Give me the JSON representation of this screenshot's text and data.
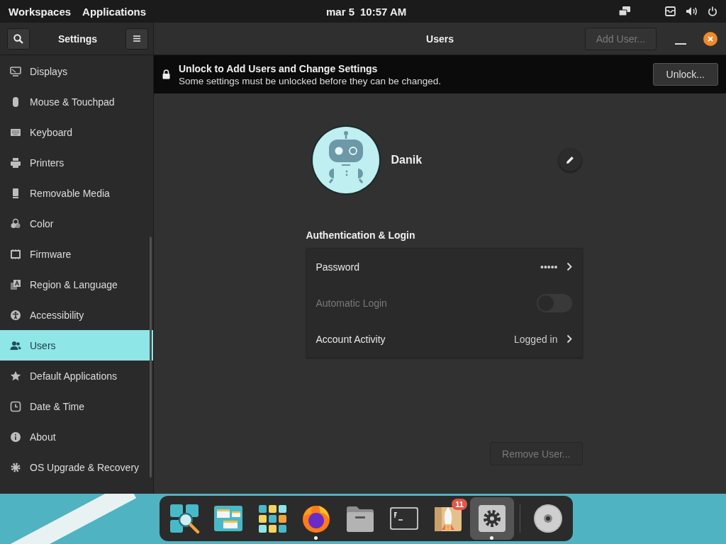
{
  "top_panel": {
    "workspaces": "Workspaces",
    "applications": "Applications",
    "date": "mar 5",
    "time": "10:57 AM"
  },
  "sidebar": {
    "title": "Settings",
    "items": [
      {
        "label": "Displays",
        "kind": "display",
        "selected": false
      },
      {
        "label": "Mouse & Touchpad",
        "kind": "mouse",
        "selected": false
      },
      {
        "label": "Keyboard",
        "kind": "keyboard",
        "selected": false
      },
      {
        "label": "Printers",
        "kind": "printer",
        "selected": false
      },
      {
        "label": "Removable Media",
        "kind": "removable",
        "selected": false
      },
      {
        "label": "Color",
        "kind": "color",
        "selected": false
      },
      {
        "label": "Firmware",
        "kind": "firmware",
        "selected": false
      },
      {
        "label": "Region & Language",
        "kind": "region",
        "selected": false
      },
      {
        "label": "Accessibility",
        "kind": "accessibility",
        "selected": false
      },
      {
        "label": "Users",
        "kind": "users",
        "selected": true
      },
      {
        "label": "Default Applications",
        "kind": "star",
        "selected": false
      },
      {
        "label": "Date & Time",
        "kind": "clock",
        "selected": false
      },
      {
        "label": "About",
        "kind": "info",
        "selected": false
      },
      {
        "label": "OS Upgrade & Recovery",
        "kind": "gear",
        "selected": false
      }
    ]
  },
  "header": {
    "title": "Users",
    "add_user": {
      "label": "Add User...",
      "disabled": true
    }
  },
  "infobar": {
    "title": "Unlock to Add Users and Change Settings",
    "message": "Some settings must be unlocked before they can be changed.",
    "button": "Unlock..."
  },
  "user": {
    "name": "Danik"
  },
  "auth": {
    "heading": "Authentication & Login",
    "rows": [
      {
        "kind": "link",
        "label": "Password",
        "value": "•••••",
        "disabled": false
      },
      {
        "kind": "switch",
        "label": "Automatic Login",
        "on": false,
        "disabled": true
      },
      {
        "kind": "link",
        "label": "Account Activity",
        "value": "Logged in",
        "disabled": false
      }
    ]
  },
  "remove_user": {
    "label": "Remove User...",
    "disabled": true
  },
  "dock": {
    "apps": [
      {
        "kind": "search",
        "running": false,
        "selected": false
      },
      {
        "kind": "multitask",
        "running": false,
        "selected": false
      },
      {
        "kind": "grid",
        "running": false,
        "selected": false
      },
      {
        "kind": "browser",
        "running": true,
        "selected": false
      },
      {
        "kind": "folder",
        "running": false,
        "selected": false
      },
      {
        "kind": "terminal",
        "running": false,
        "selected": false
      },
      {
        "kind": "store",
        "running": false,
        "selected": false,
        "badge": "11"
      },
      {
        "kind": "settings",
        "running": true,
        "selected": true
      },
      {
        "kind": "disc",
        "running": false,
        "selected": false
      }
    ]
  }
}
